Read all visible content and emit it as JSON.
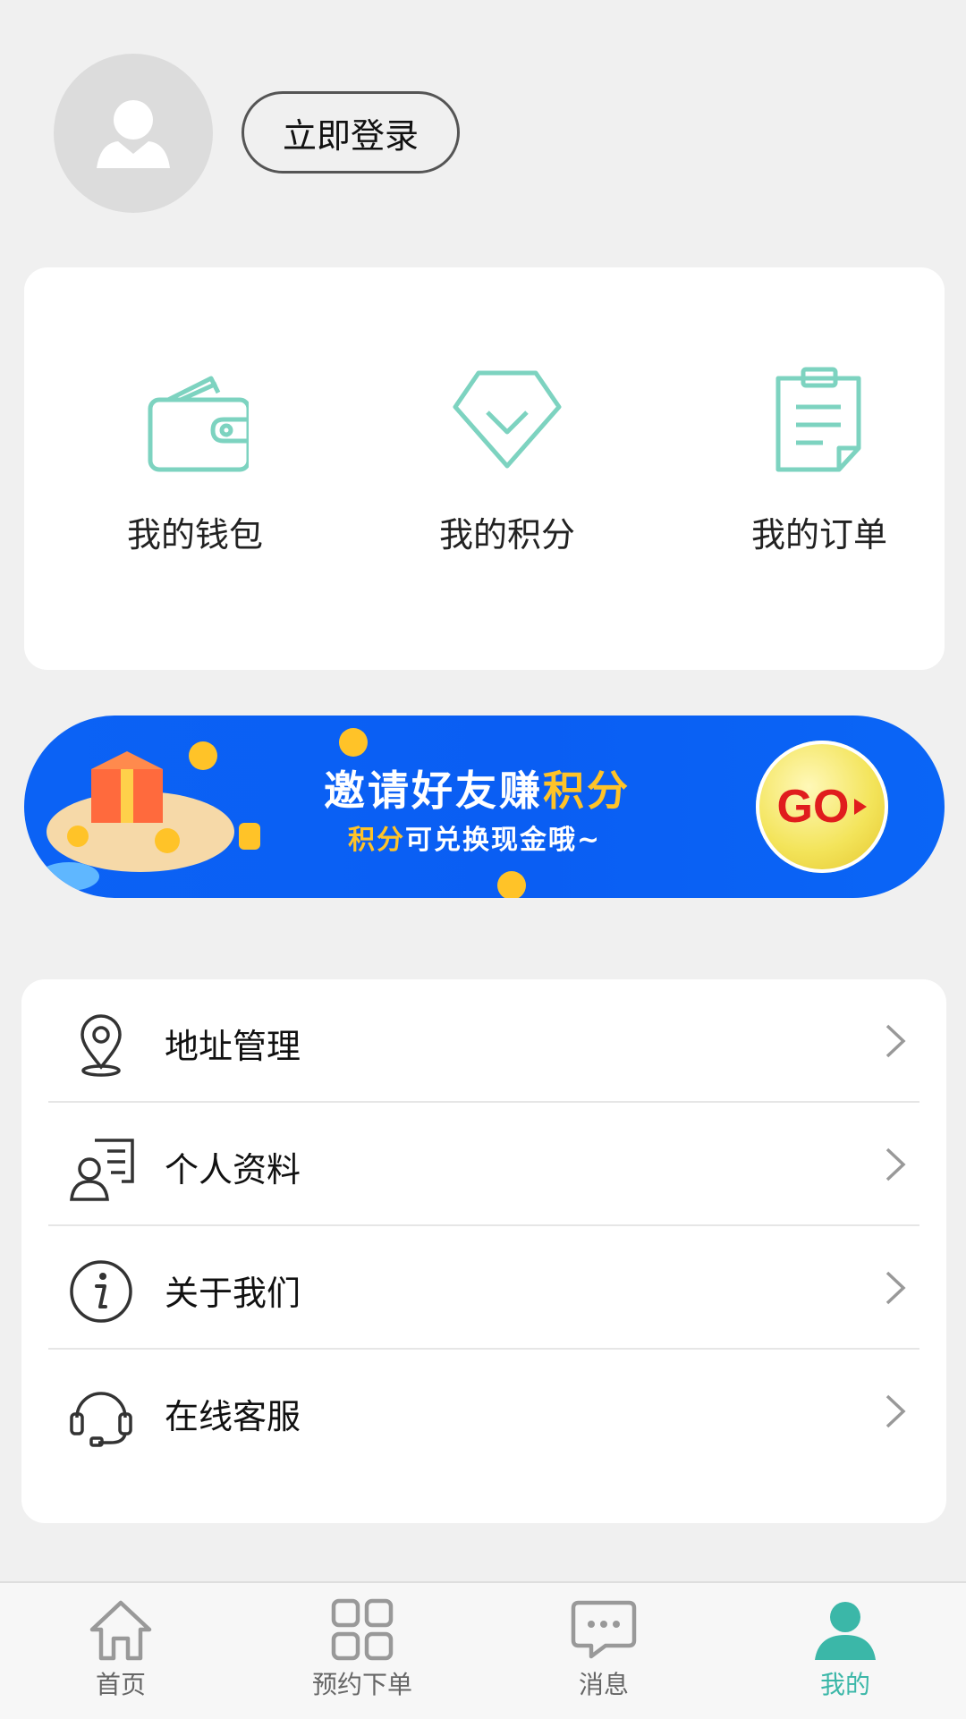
{
  "header": {
    "login_label": "立即登录"
  },
  "quick_actions": [
    {
      "label": "我的钱包",
      "icon": "wallet-icon"
    },
    {
      "label": "我的积分",
      "icon": "diamond-icon"
    },
    {
      "label": "我的订单",
      "icon": "clipboard-icon"
    }
  ],
  "banner": {
    "title_main": "邀请好友赚",
    "title_highlight": "积分",
    "subtitle_highlight": "积分",
    "subtitle_rest": "可兑换现金哦~",
    "go_label": "GO"
  },
  "menu": [
    {
      "label": "地址管理",
      "icon": "location-pin-icon"
    },
    {
      "label": "个人资料",
      "icon": "profile-card-icon"
    },
    {
      "label": "关于我们",
      "icon": "info-icon"
    },
    {
      "label": "在线客服",
      "icon": "headset-icon"
    }
  ],
  "tabbar": [
    {
      "label": "首页",
      "icon": "home-icon"
    },
    {
      "label": "预约下单",
      "icon": "grid-icon"
    },
    {
      "label": "消息",
      "icon": "chat-bubble-icon"
    },
    {
      "label": "我的",
      "icon": "person-icon"
    }
  ],
  "colors": {
    "accent": "#3bb7a8",
    "icon_teal": "#7dd3c0",
    "banner_blue": "#0a60f4",
    "banner_highlight": "#ffc328"
  }
}
